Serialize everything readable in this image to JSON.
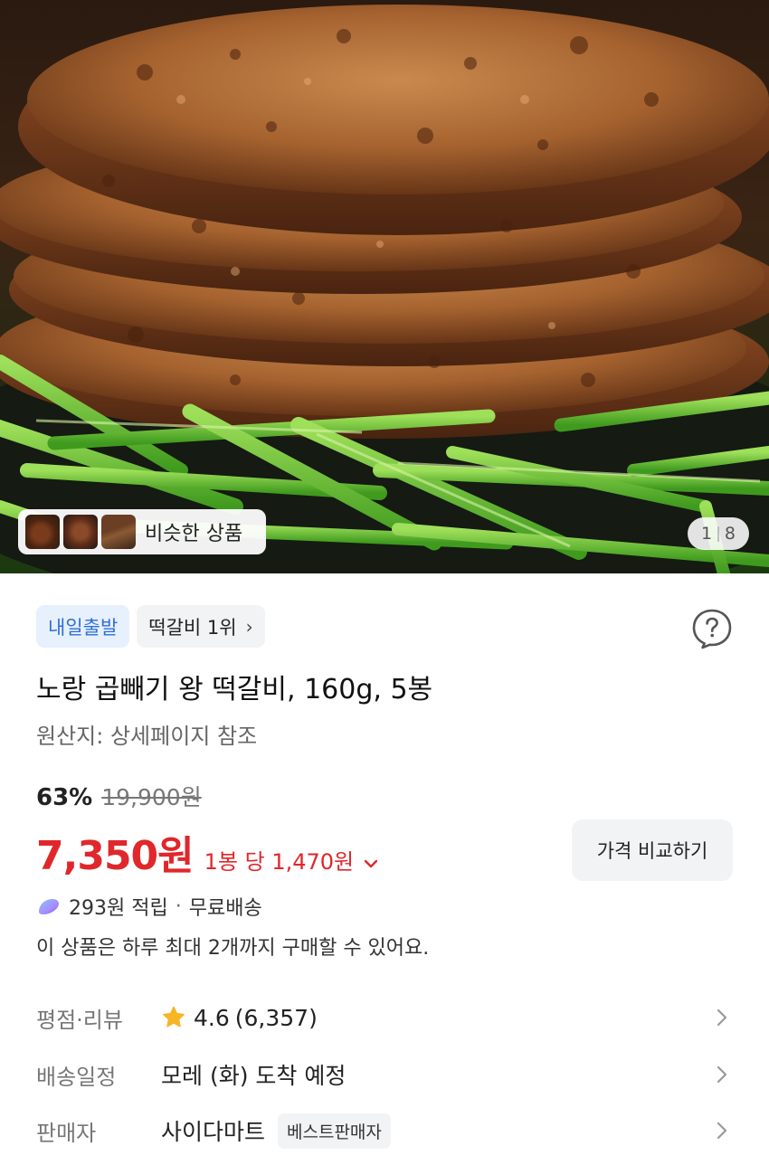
{
  "hero": {
    "similar_label": "비슷한 상품",
    "page_current": "1",
    "page_total": "8"
  },
  "badges": {
    "delivery": "내일출발",
    "ranking": "떡갈비 1위"
  },
  "product": {
    "title": "노랑 곱빼기 왕 떡갈비, 160g, 5봉",
    "origin": "원산지: 상세페이지 참조"
  },
  "pricing": {
    "discount": "63%",
    "original_price": "19,900원",
    "sale_price": "7,350원",
    "unit_price": "1봉 당 1,470원",
    "compare_label": "가격 비교하기",
    "accent_color": "#e0272b"
  },
  "benefits": {
    "points": "293원 적립",
    "shipping": "무료배송",
    "limit_notice": "이 상품은 하루 최대 2개까지 구매할 수 있어요."
  },
  "details": {
    "rating_label": "평점·리뷰",
    "rating_value": "4.6",
    "review_count": "(6,357)",
    "delivery_label": "배송일정",
    "delivery_value": "모레 (화) 도착 예정",
    "seller_label": "판매자",
    "seller_name": "사이다마트",
    "seller_badge": "베스트판매자"
  }
}
